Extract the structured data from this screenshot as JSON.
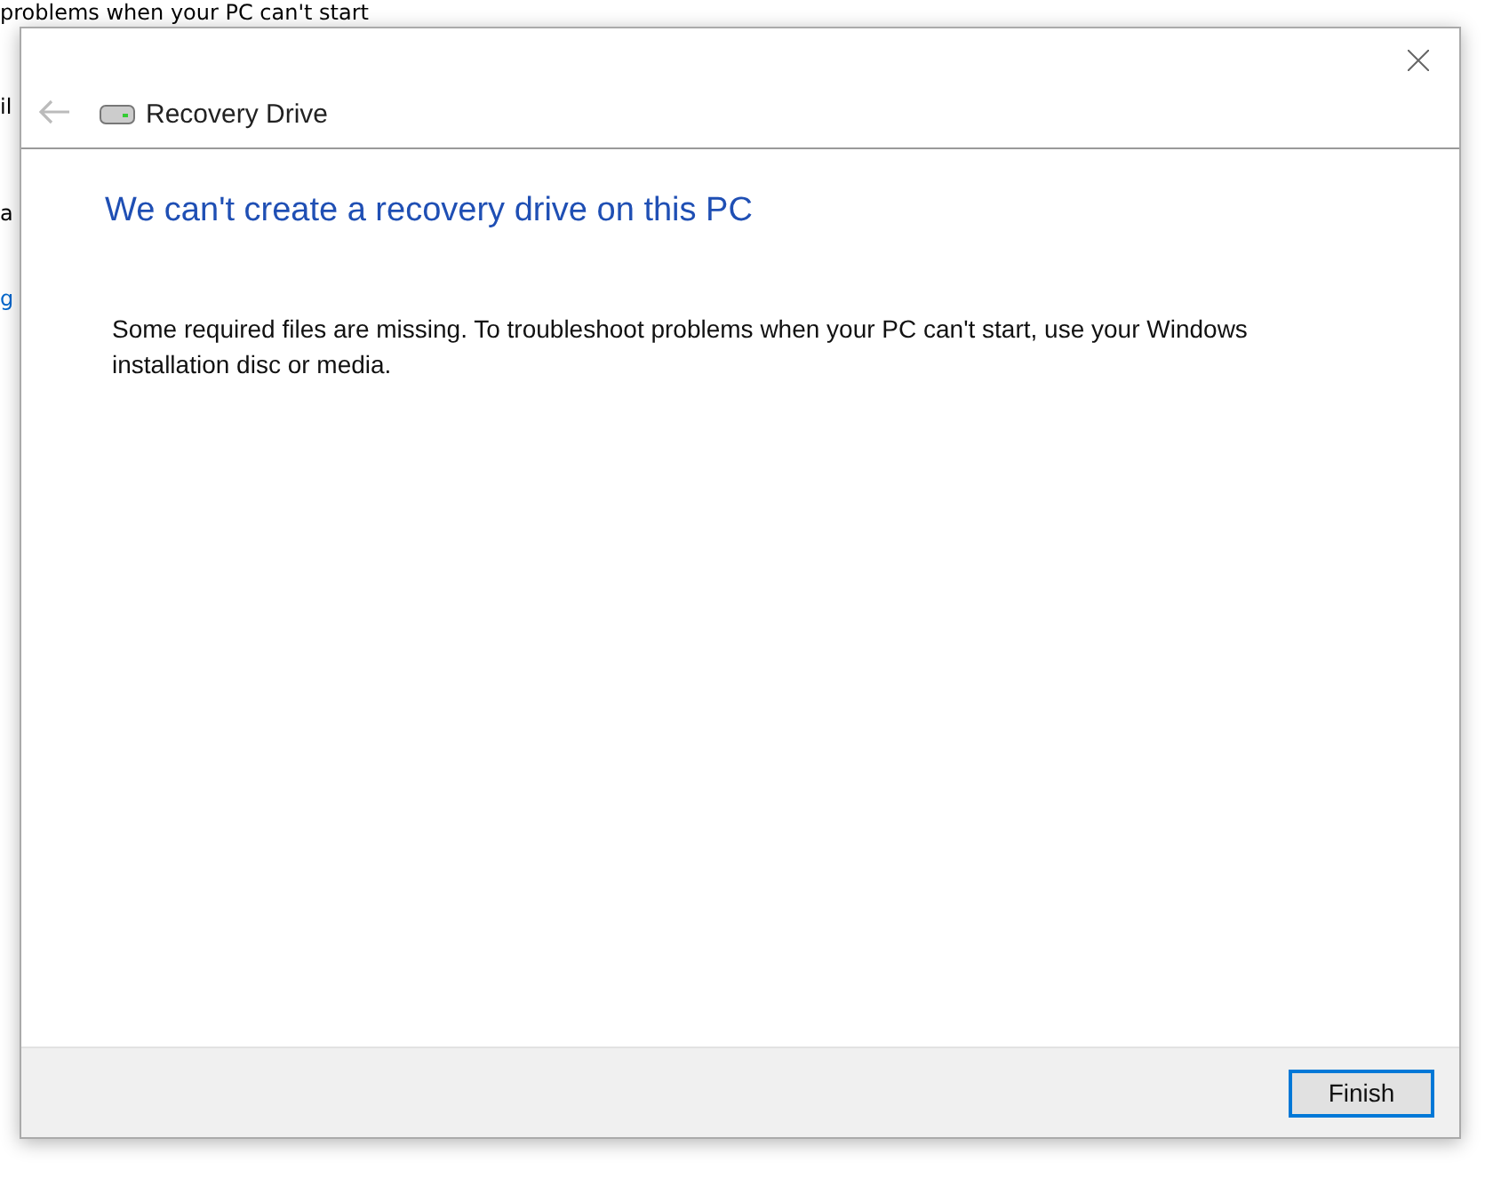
{
  "background_page": {
    "lines": [
      {
        "text": "problems when your PC can't start",
        "kind": "text"
      },
      {
        "text": "il",
        "kind": "text"
      },
      {
        "text": "a",
        "kind": "text"
      },
      {
        "text": "g",
        "kind": "link"
      }
    ]
  },
  "window": {
    "title": "Recovery Drive",
    "back_disabled": true
  },
  "heading": "We can't create a recovery drive on this PC",
  "message": "Some required files are missing. To troubleshoot problems when your PC can't start, use your Windows installation disc or media.",
  "buttons": [
    {
      "label": "Finish",
      "selected": true
    }
  ]
}
